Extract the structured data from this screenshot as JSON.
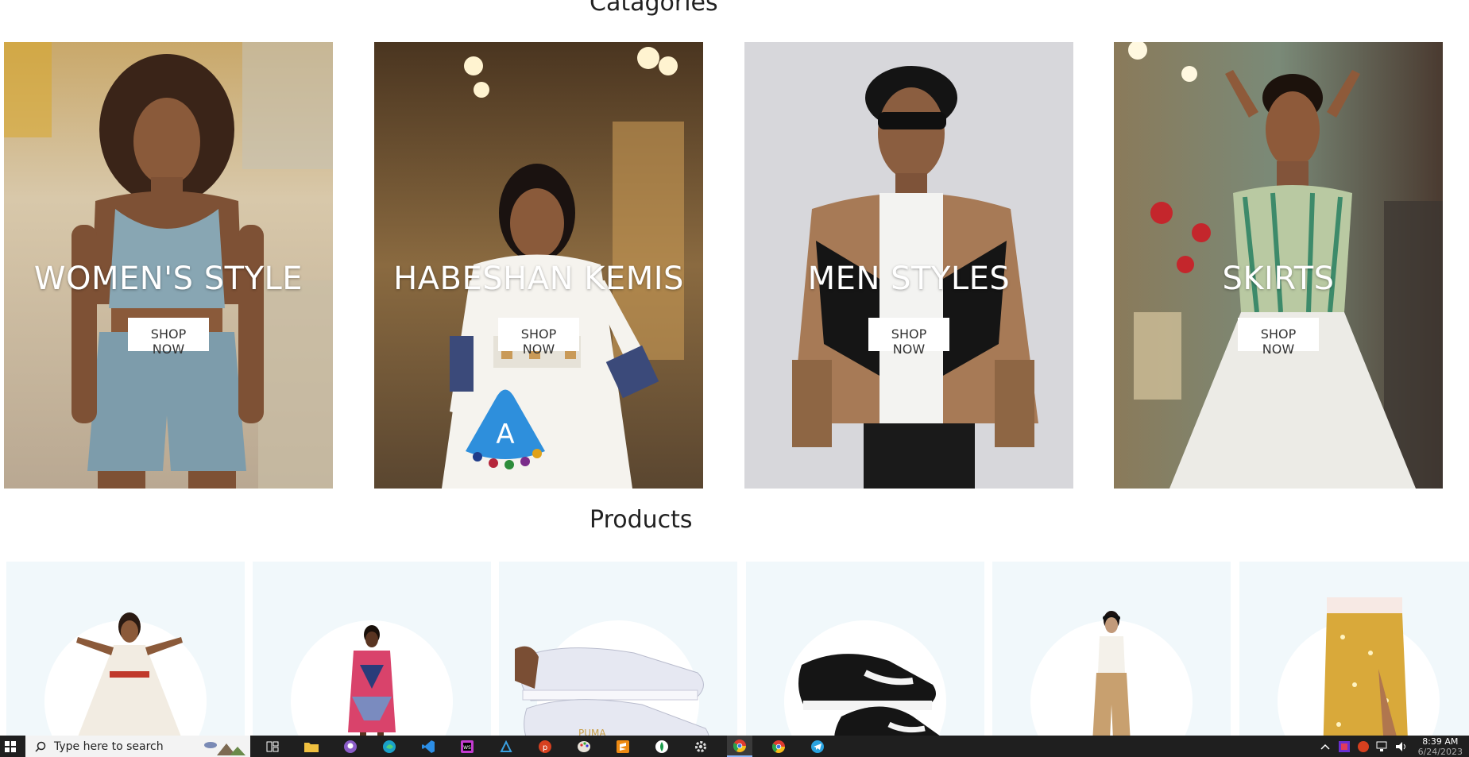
{
  "sections": {
    "categories_title": "Catagories",
    "products_title": "Products"
  },
  "categories": [
    {
      "title": "WOMEN'S STYLE",
      "button": "SHOP NOW"
    },
    {
      "title": "HABESHAN KEMIS",
      "button": "SHOP NOW"
    },
    {
      "title": "MEN STYLES",
      "button": "SHOP NOW"
    },
    {
      "title": "SKIRTS",
      "button": "SHOP NOW"
    }
  ],
  "products": [
    {
      "name": "habesha-dress"
    },
    {
      "name": "pink-print-dress"
    },
    {
      "name": "white-puma-sneakers"
    },
    {
      "name": "black-puma-sneakers"
    },
    {
      "name": "tan-pants-outfit"
    },
    {
      "name": "yellow-floral-skirt"
    }
  ],
  "taskbar": {
    "search_placeholder": "Type here to search",
    "time": "8:39 AM",
    "date": "6/24/2023"
  },
  "colors": {
    "product_bg": "#f1f8fb",
    "taskbar_bg": "#1f1f1f"
  }
}
